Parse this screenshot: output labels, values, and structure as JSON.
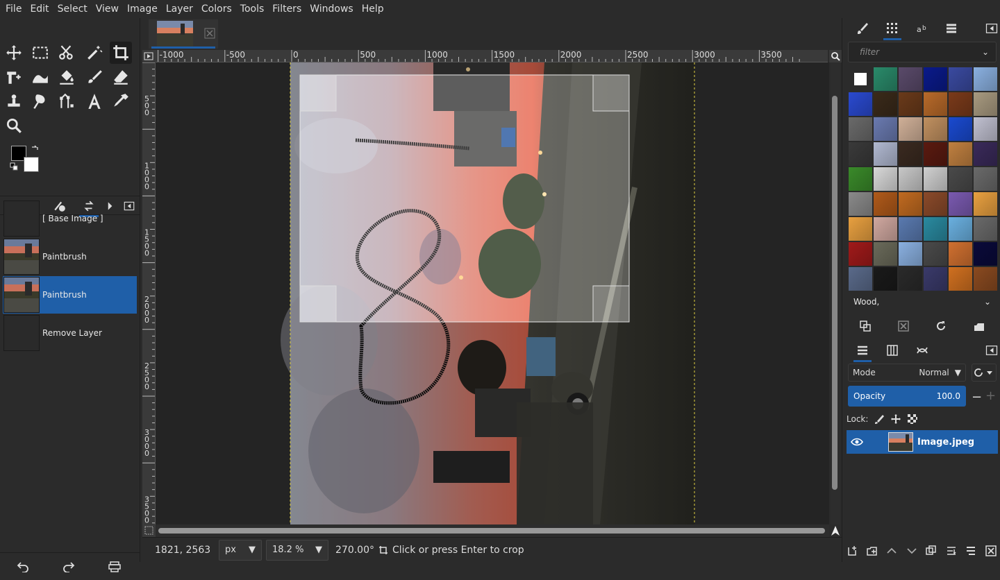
{
  "menu": [
    "File",
    "Edit",
    "Select",
    "View",
    "Image",
    "Layer",
    "Colors",
    "Tools",
    "Filters",
    "Windows",
    "Help"
  ],
  "history": {
    "items": [
      {
        "label": "[ Base Image ]",
        "thumb": "empty"
      },
      {
        "label": "Paintbrush",
        "thumb": "photo"
      },
      {
        "label": "Paintbrush",
        "thumb": "photo",
        "selected": true
      },
      {
        "label": "Remove Layer",
        "thumb": "empty"
      }
    ]
  },
  "ruler": {
    "top_labels": [
      "-1000",
      "-500",
      "0",
      "500",
      "1000",
      "1500",
      "2000",
      "2500",
      "3000",
      "3500"
    ],
    "left_labels": [
      "500",
      "1000",
      "1500",
      "2000",
      "2500",
      "3000",
      "3500"
    ]
  },
  "status": {
    "coords": "1821, 2563",
    "unit": "px",
    "zoom": "18.2 %",
    "angle": "270.00°",
    "message": "Click or press Enter to crop"
  },
  "patterns": {
    "filter_placeholder": "filter",
    "selected_name": "Wood,",
    "colors": [
      "#ffffff",
      "#2a8a6a",
      "#5a4a6a",
      "#0a1a8a",
      "#3a4aa0",
      "#8ab0e0",
      "#2a4ad0",
      "#3a2a1a",
      "#6a3a1a",
      "#b86a2a",
      "#7a3a1a",
      "#a89a80",
      "#6a6a6a",
      "#6a7ab0",
      "#d0b098",
      "#c09060",
      "#1a4ad0",
      "#c0c0d0",
      "#3a3a3a",
      "#b0b8d0",
      "#3a2a20",
      "#5a1a10",
      "#c08040",
      "#3a2a5a",
      "#3a8a2a",
      "#d8d8d8",
      "#c8c8c8",
      "#d0d0d0",
      "#4a4a4a",
      "#6a6a6a",
      "#8a8a8a",
      "#b05a1a",
      "#c06a20",
      "#8a4a2a",
      "#7a5ab0",
      "#e8a040",
      "#e8a040",
      "#d0a8a0",
      "#5a7ab0",
      "#2a8aa0",
      "#6ab0e0",
      "#6a6a6a",
      "#a01a1a",
      "#6a6a5a",
      "#8ab0e0",
      "#4a4a4a",
      "#d07030",
      "#0a0a3a",
      "#5a6a8a",
      "#1a1a1a",
      "#2a2a2a",
      "#3a3a6a",
      "#d07020",
      "#8a4a20"
    ]
  },
  "layers": {
    "mode_label": "Mode",
    "mode_value": "Normal",
    "opacity_label": "Opacity",
    "opacity_value": "100.0",
    "lock_label": "Lock:",
    "layer_name": "Image.jpeg"
  },
  "colors": {
    "accent": "#1f5fa8",
    "fg": "#000000",
    "bg": "#ffffff"
  }
}
